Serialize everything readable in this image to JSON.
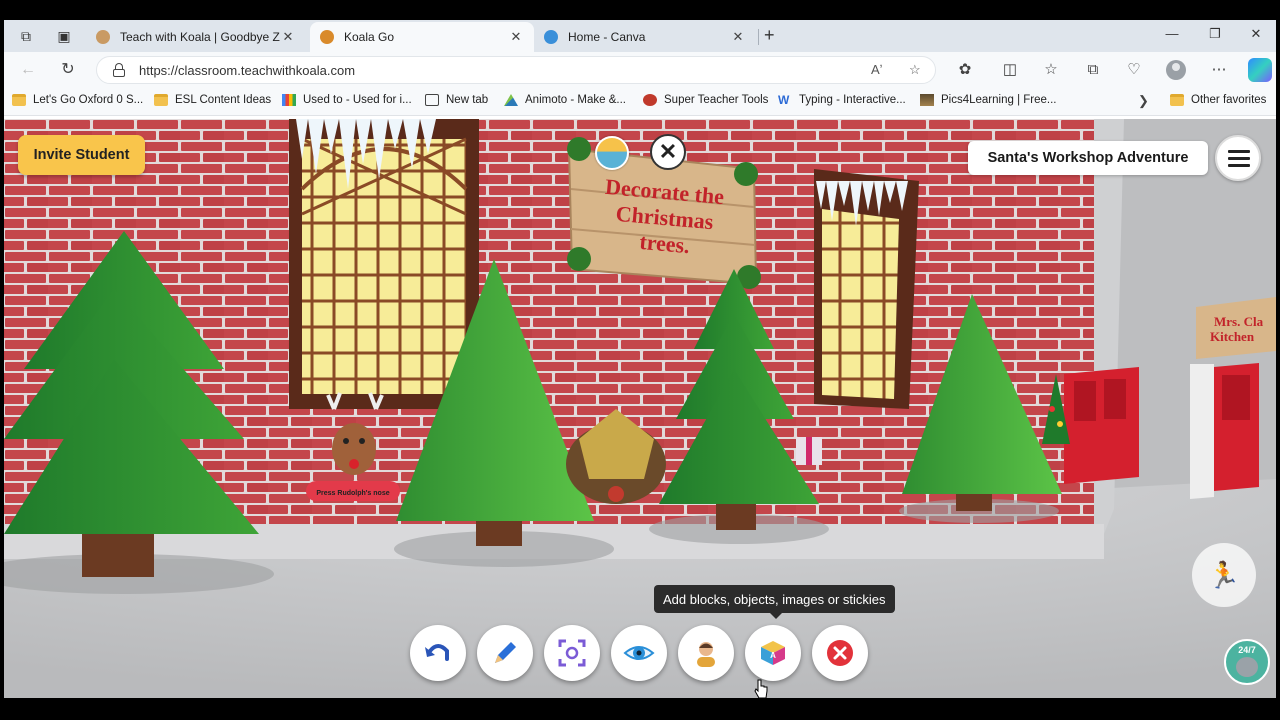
{
  "browser": {
    "tabs": [
      {
        "title": "Teach with Koala | Goodbye Zoom",
        "favicon_color": "#c99a63",
        "active": false
      },
      {
        "title": "Koala Go",
        "favicon_color": "#d98a2b",
        "active": true
      },
      {
        "title": "Home - Canva",
        "favicon_color": "#3a8fd9",
        "active": false
      }
    ],
    "new_tab_glyph": "+",
    "window_controls": {
      "minimize": "—",
      "restore": "❐",
      "close": "✕"
    },
    "url": "https://classroom.teachwithkoala.com",
    "bookmarks": [
      {
        "label": "Let's Go Oxford 0 S...",
        "icon": "folder-icon"
      },
      {
        "label": "ESL Content Ideas",
        "icon": "folder-icon"
      },
      {
        "label": "Used to - Used for i...",
        "icon": "google-icon"
      },
      {
        "label": "New tab",
        "icon": "newtab-icon"
      },
      {
        "label": "Animoto - Make &...",
        "icon": "animoto-icon"
      },
      {
        "label": "Super Teacher Tools",
        "icon": "gear-icon"
      },
      {
        "label": "Typing - Interactive...",
        "icon": "w-icon"
      },
      {
        "label": "Pics4Learning | Free...",
        "icon": "image-icon"
      }
    ],
    "other_favorites": "Other favorites"
  },
  "app": {
    "invite_button": "Invite Student",
    "room_title": "Santa's Workshop Adventure",
    "sign_text": [
      "Decorate the",
      "Christmas",
      "trees."
    ],
    "kitchen_sign": [
      "Mrs. Cla",
      "Kitchen"
    ],
    "rudolph_sign": "Press Rudolph's nose",
    "tooltip": "Add blocks, objects, images or stickies",
    "help_badge": "24/7",
    "toolbar": [
      {
        "name": "undo-button",
        "icon": "undo-icon"
      },
      {
        "name": "draw-button",
        "icon": "pencil-icon"
      },
      {
        "name": "focus-button",
        "icon": "focus-icon"
      },
      {
        "name": "view-button",
        "icon": "eye-icon"
      },
      {
        "name": "avatar-button",
        "icon": "avatar-icon"
      },
      {
        "name": "add-objects-button",
        "icon": "blocks-icon"
      },
      {
        "name": "exit-button",
        "icon": "close-circle-icon"
      }
    ]
  },
  "colors": {
    "brick": "#c4464b",
    "mortar": "#e2dada",
    "tree_dark": "#1f7a2b",
    "tree_light": "#48b43a",
    "invite_yellow": "#f9c54b",
    "exit_red": "#e2323a",
    "floor": "#c8c9cb"
  }
}
